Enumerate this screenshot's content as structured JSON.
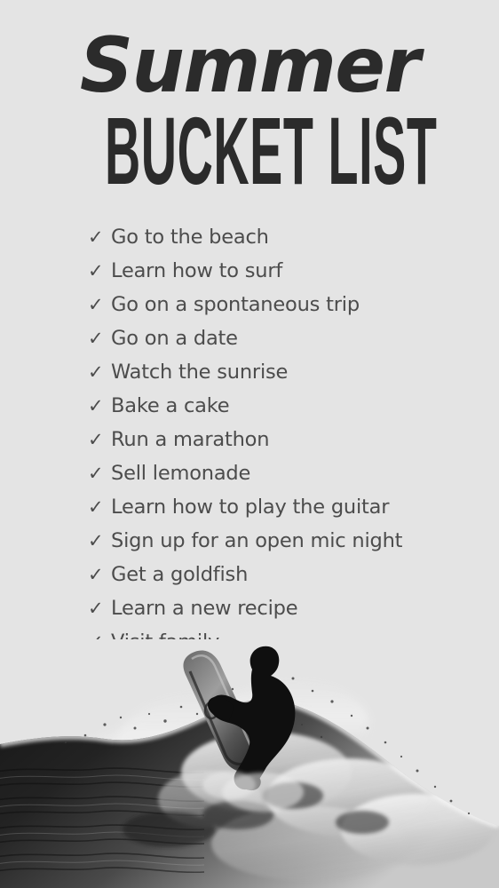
{
  "poster": {
    "background_color": "#e4e4e4",
    "title": {
      "script_line": "Summer",
      "main_line": "BUCKET LIST",
      "color": "#2b2b2b"
    },
    "checklist": {
      "check_glyph": "✓",
      "text_color": "#4c4c4c",
      "items": [
        {
          "label": "Go to the beach"
        },
        {
          "label": "Learn how to surf"
        },
        {
          "label": "Go on a spontaneous trip"
        },
        {
          "label": "Go on a date"
        },
        {
          "label": "Watch the sunrise"
        },
        {
          "label": "Bake a cake"
        },
        {
          "label": "Run a marathon"
        },
        {
          "label": "Sell lemonade"
        },
        {
          "label": "Learn how to play the guitar"
        },
        {
          "label": "Sign up for an open mic night"
        },
        {
          "label": "Get a goldfish"
        },
        {
          "label": "Learn a new recipe"
        },
        {
          "label": "Visit family"
        }
      ]
    },
    "photo": {
      "description": "black and white photo of a surfer riding a breaking wave",
      "surfer_color": "#101010",
      "wave_dark_color": "#262626",
      "wave_foam_color": "#f2f2f2"
    }
  }
}
